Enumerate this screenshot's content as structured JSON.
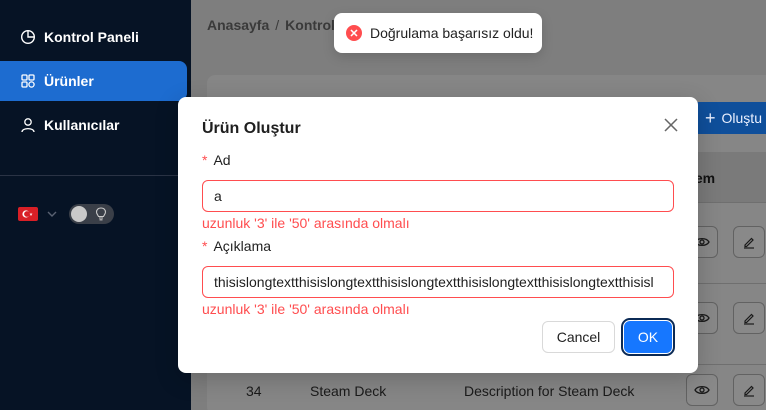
{
  "sidebar": {
    "items": [
      {
        "label": "Kontrol Paneli",
        "icon": "dashboard-icon",
        "active": false
      },
      {
        "label": "Ürünler",
        "icon": "products-icon",
        "active": true
      },
      {
        "label": "Kullanıcılar",
        "icon": "user-icon",
        "active": false
      }
    ],
    "language_flag": "turkey-flag-icon",
    "theme_toggle": "off"
  },
  "breadcrumb": {
    "home": "Anasayfa",
    "separator": "/",
    "current": "Kontrol"
  },
  "toolbar": {
    "create_label": "Oluştu"
  },
  "table": {
    "action_header": "lem",
    "visible_row": {
      "id": "34",
      "name": "Steam Deck",
      "description": "Description for Steam Deck"
    }
  },
  "toast": {
    "type": "error",
    "message": "Doğrulama başarısız oldu!"
  },
  "modal": {
    "title": "Ürün Oluştur",
    "fields": [
      {
        "label": "Ad",
        "required": true,
        "value": "a",
        "error": "uzunluk '3' ile '50' arasında olmalı"
      },
      {
        "label": "Açıklama",
        "required": true,
        "value": "thisislongtextthisislongtextthisislongtextthisislongtextthisislongtextthisisl",
        "error": "uzunluk '3' ile '50' arasında olmalı"
      }
    ],
    "cancel_label": "Cancel",
    "ok_label": "OK"
  },
  "colors": {
    "primary": "#1677ff",
    "error": "#ff4d4f",
    "sidebar_bg": "#061325",
    "sidebar_active": "#1d6cd0"
  }
}
